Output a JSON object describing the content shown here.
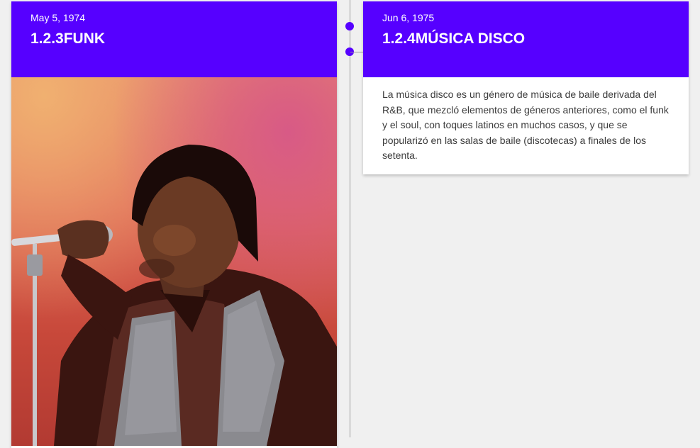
{
  "timeline": {
    "items": [
      {
        "date": "May 5, 1974",
        "title": "1.2.3FUNK",
        "image": "singer-with-microphone-photo"
      },
      {
        "date": "Jun 6, 1975",
        "title": "1.2.4MÚSICA DISCO",
        "body": "La música disco es un género de música de baile derivada del R&B, que mezcló elementos de géneros anteriores, como el funk y el soul, con toques latinos en muchos casos, y que se popularizó en las salas de baile (discotecas) a finales de los setenta."
      }
    ]
  },
  "colors": {
    "accent": "#5600ff",
    "background": "#f0f0f0",
    "line": "#9a9a9a",
    "text": "#3b3b3b"
  }
}
